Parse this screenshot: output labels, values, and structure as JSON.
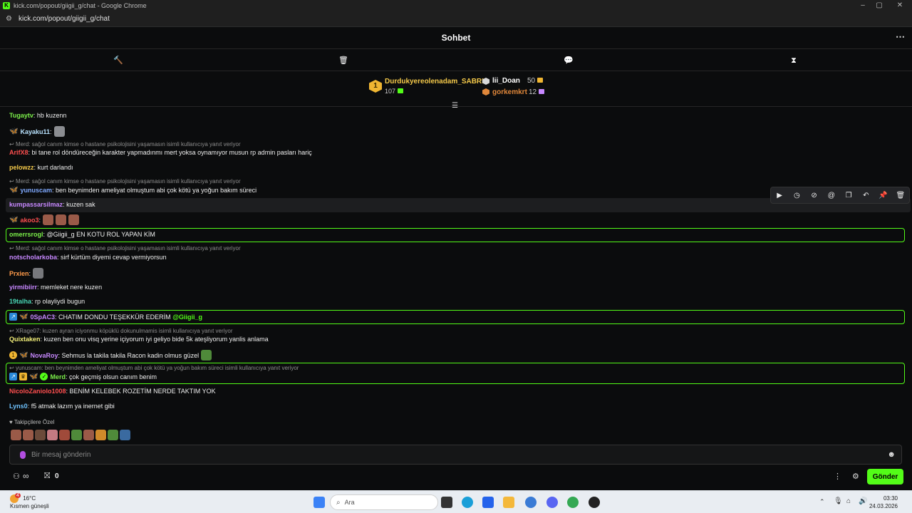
{
  "browser": {
    "title": "kick.com/popout/giigii_g/chat - Google Chrome",
    "url": "kick.com/popout/giigii_g/chat"
  },
  "chat": {
    "title": "Sohbet"
  },
  "leaderboard": {
    "first": {
      "rank": "1",
      "name": "Durdukyereolenadam_SABRI",
      "value": "107"
    },
    "second": {
      "name": "lii_Doan",
      "value": "50"
    },
    "third": {
      "name": "gorkemkrt",
      "value": "12"
    }
  },
  "messages": [
    {
      "user": "Tugaytv",
      "color": "#7cf04a",
      "text": "hb kuzenn"
    },
    {
      "user": "Kayaku11",
      "color": "#b9e3ff",
      "text": ""
    },
    {
      "reply": "Merd: sağol canım kimse o hastane psikolojisini yaşamasın isimli kullanıcıya yanıt veriyor",
      "user": "ArifX8",
      "color": "#ff4f4f",
      "text": "bi tane rol döndüreceğin karakter yapmadınmı mert yoksa oynamıyor musun rp admin pasları hariç"
    },
    {
      "user": "pelowzz",
      "color": "#f4c94a",
      "text": "kurt darlandı"
    },
    {
      "reply": "Merd: sağol canım kimse o hastane psikolojisini yaşamasın isimli kullanıcıya yanıt veriyor",
      "user": "yunuscam",
      "color": "#7fa9ff",
      "text": "ben beynimden ameliyat olmuştum abi çok kötü ya yoğun bakım süreci"
    },
    {
      "user": "kumpassarsilmaz",
      "color": "#c788ff",
      "text": "kuzen sak"
    },
    {
      "user": "akoo3",
      "color": "#ff4f4f",
      "text": ""
    },
    {
      "user": "omerrsrogl",
      "color": "#7cf04a",
      "text": "@Giigii_g EN KOTU ROL YAPAN KİM"
    },
    {
      "reply": "Merd: sağol canım kimse o hastane psikolojisini yaşamasın isimli kullanıcıya yanıt veriyor",
      "user": "notscholarkoba",
      "color": "#c788ff",
      "text": "sirf kürtüm diyemi cevap vermiyorsun"
    },
    {
      "user": "Prxien",
      "color": "#ff9b4a",
      "text": ""
    },
    {
      "user": "yirmibiirr",
      "color": "#c788ff",
      "text": "memleket nere kuzen"
    },
    {
      "user": "19talha",
      "color": "#48d6b5",
      "text": "rp olayliydi bugun"
    },
    {
      "user": "0SpAC3",
      "color": "#c788ff",
      "text": "CHATIM DONDU TEŞEKKÜR EDERİM",
      "mention": "@Giigii_g"
    },
    {
      "reply": "XRage07: kuzen ayran iciyonmu köpüklü dokunulmamis isimli kullanıcıya yanıt veriyor",
      "user": "Quixtaken",
      "color": "#f4f07a",
      "text": "kuzen ben onu visq yerine içiyorum iyi geliyo bide 5k ateşliyorum yanlis anlama"
    },
    {
      "user": "NovaRoy",
      "color": "#c788ff",
      "text": "Sehmus la takila takila Racon kadin olmus güzel"
    },
    {
      "reply": "yunuscam: ben beynimden ameliyat olmuştum abi çok kötü ya yoğun bakım süreci isimli kullanıcıya yanıt veriyor",
      "user": "Merd",
      "color": "#7cf04a",
      "text": "çok geçmiş olsun canım benim"
    },
    {
      "user": "NicoloZaniolo1008",
      "color": "#ff4f4f",
      "text": "BENİM KELEBEK ROZETİM NERDE TAKTIM YOK"
    },
    {
      "user": "Lyns0",
      "color": "#6fc3ff",
      "text": "f5 atmak lazım ya inernet gibi"
    }
  ],
  "followers_label": "Takipçilere Özel",
  "input": {
    "placeholder": "Bir mesaj gönderin"
  },
  "bottom": {
    "viewers": "∞",
    "count": "0",
    "send": "Gönder"
  },
  "taskbar": {
    "temp": "16°C",
    "weather": "Kısmen güneşli",
    "search": "Ara",
    "time": "03:30",
    "date": "24.03.2026",
    "notif": "4"
  }
}
